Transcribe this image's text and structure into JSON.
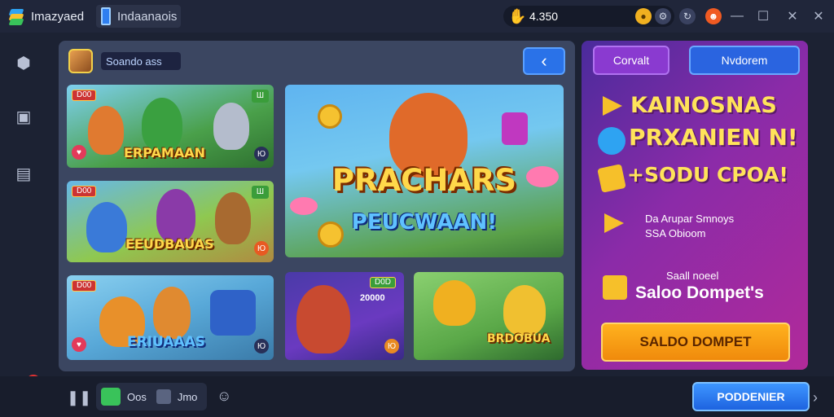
{
  "titlebar": {
    "app_name": "Imazyaed",
    "tab_label": "Indaanaois",
    "coin_balance": "4.350",
    "close_glyph": "✕",
    "min_glyph": "—",
    "max_glyph": "☐"
  },
  "library": {
    "search_label": "Soando ass",
    "back_glyph": "‹",
    "cards": [
      {
        "tag_left": "D00",
        "tag_right": "Ш",
        "title": "ERPAMAAN",
        "corner": "Ю"
      },
      {
        "tag_left": "D00",
        "tag_right": "Ш",
        "title": "EEUDBAUAS",
        "corner": "Ю"
      },
      {
        "tag_left": "D00",
        "title": "ERIUAAAS",
        "corner": "Ю"
      },
      {
        "tag_left": "D0D",
        "subtitle": "20000",
        "corner": "Ю"
      },
      {
        "title": "BRDOBUA"
      }
    ],
    "hero": {
      "title": "PRACHARS",
      "subtitle": "PEUCWAAN!"
    }
  },
  "promo": {
    "btn_left": "Corvalt",
    "btn_right": "Nvdorem",
    "line1": "KAINOSNAS",
    "line2": "PRXANIEN N!",
    "line3": "+SODU CPOA!",
    "info1_line1": "Da Arupar Smnoys",
    "info1_line2": "SSA Obioom",
    "info2_label": "Saall noeel",
    "info2_value": "Saloo Dompet's",
    "cta_label": "SALDO DOMPET"
  },
  "bottom": {
    "user_text1": "Oos",
    "user_text2": "Jmo",
    "confirm_label": "PODDENIER"
  },
  "notifications": {
    "count": "1"
  },
  "colors": {
    "accent_blue": "#2a72e8",
    "promo_purple": "#8b2ba8",
    "cta_orange": "#ffb21e",
    "title_yellow": "#ffd84a"
  }
}
